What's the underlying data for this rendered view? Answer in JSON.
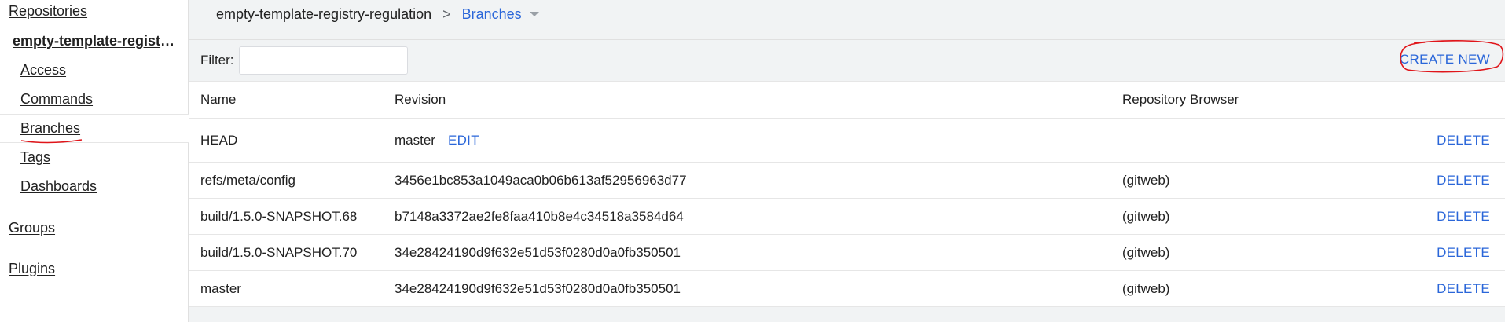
{
  "sidebar": {
    "repositories_label": "Repositories",
    "repo_name": "empty-template-registry-regulation",
    "items": [
      {
        "label": "Access"
      },
      {
        "label": "Commands"
      },
      {
        "label": "Branches",
        "selected": true
      },
      {
        "label": "Tags"
      },
      {
        "label": "Dashboards"
      }
    ],
    "groups_label": "Groups",
    "plugins_label": "Plugins"
  },
  "breadcrumb": {
    "repo": "empty-template-registry-regulation",
    "separator": ">",
    "current": "Branches"
  },
  "filter": {
    "label": "Filter:",
    "value": "",
    "placeholder": ""
  },
  "actions": {
    "create_new": "CREATE NEW"
  },
  "table": {
    "columns": [
      "Name",
      "Revision",
      "Repository Browser"
    ],
    "rows": [
      {
        "name": "HEAD",
        "revision": "master",
        "edit": "EDIT",
        "browser": "",
        "action": "DELETE"
      },
      {
        "name": "refs/meta/config",
        "revision": "3456e1bc853a1049aca0b06b613af52956963d77",
        "browser": "(gitweb)",
        "action": "DELETE"
      },
      {
        "name": "build/1.5.0-SNAPSHOT.68",
        "revision": "b7148a3372ae2fe8faa410b8e4c34518a3584d64",
        "browser": "(gitweb)",
        "action": "DELETE"
      },
      {
        "name": "build/1.5.0-SNAPSHOT.70",
        "revision": "34e28424190d9f632e51d53f0280d0a0fb350501",
        "browser": "(gitweb)",
        "action": "DELETE"
      },
      {
        "name": "master",
        "revision": "34e28424190d9f632e51d53f0280d0a0fb350501",
        "browser": "(gitweb)",
        "action": "DELETE"
      }
    ]
  },
  "colors": {
    "link": "#2a66d9",
    "annotation": "#e0151a",
    "page_bg": "#f1f3f4"
  }
}
